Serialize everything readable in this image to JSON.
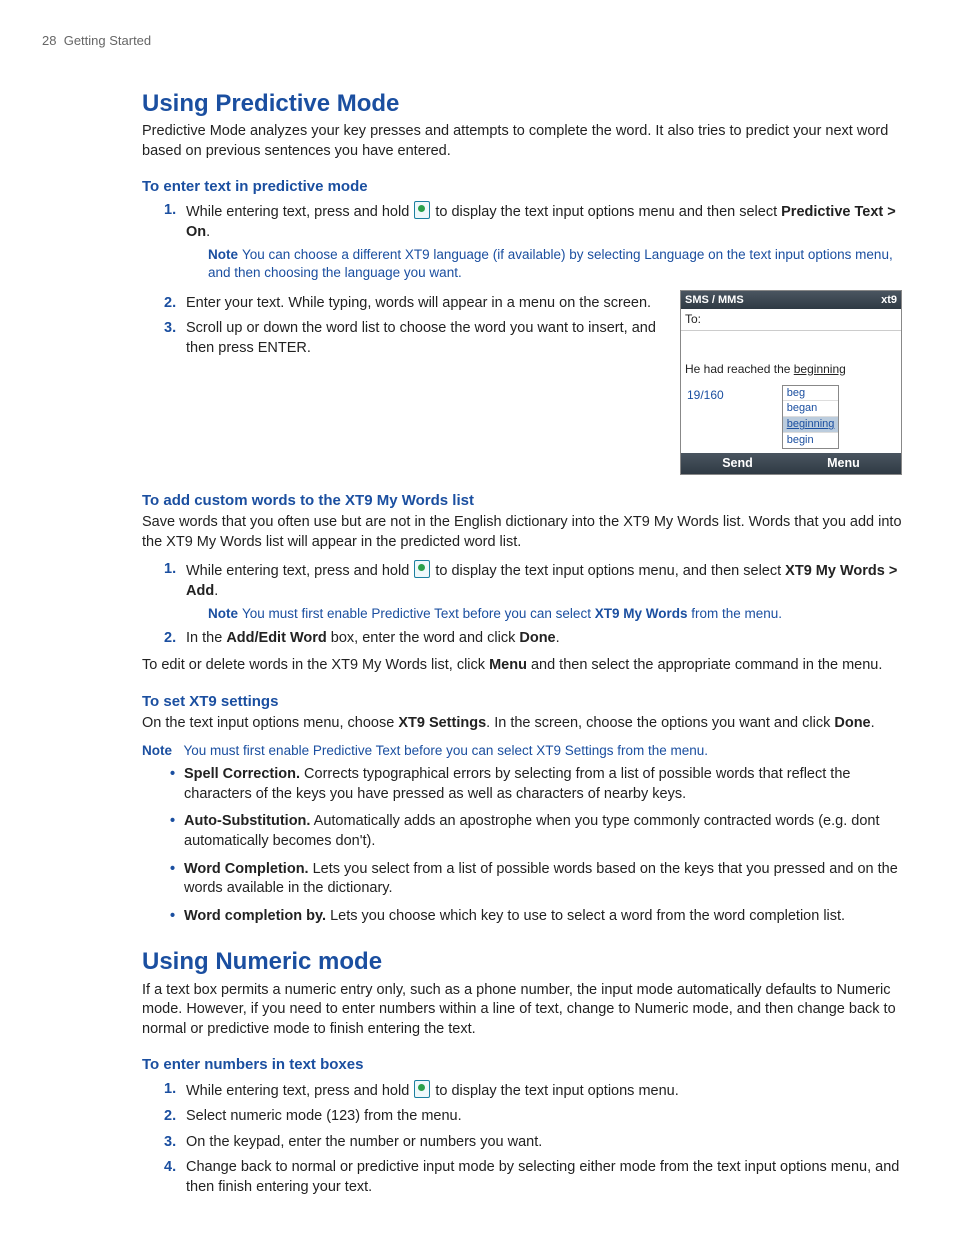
{
  "header": {
    "page_number": "28",
    "section": "Getting Started"
  },
  "predictive": {
    "title": "Using Predictive Mode",
    "intro": "Predictive Mode analyzes your key presses and attempts to complete the word. It also tries to predict your next word based on previous sentences you have entered.",
    "enter": {
      "heading": "To enter text in predictive mode",
      "step1_a": "While entering text, press and hold ",
      "step1_b": " to display the text input options menu and then select ",
      "step1_bold": "Predictive Text > On",
      "step1_c": ".",
      "note_label": "Note",
      "note": "You can choose a different XT9 language (if available) by selecting Language on the text input options menu, and then choosing the language you want.",
      "step2": "Enter your text. While typing, words will appear in a menu on the screen.",
      "step3": "Scroll up or down the word list to choose the word you want to insert, and then press ENTER."
    },
    "custom": {
      "heading": "To add custom words to the XT9 My Words list",
      "intro": "Save words that you often use but are not in the English dictionary into the XT9 My Words list. Words that you add into the XT9 My Words list will appear in the predicted word list.",
      "step1_a": "While entering text, press and hold ",
      "step1_b": " to display the text input options menu, and then select ",
      "step1_bold": "XT9 My Words > Add",
      "step1_c": ".",
      "note_label": "Note",
      "note_a": "You must first enable Predictive Text before you can select ",
      "note_bold": "XT9 My Words",
      "note_b": " from the menu.",
      "step2_a": "In the ",
      "step2_bold1": "Add/Edit Word",
      "step2_b": " box, enter the word and click ",
      "step2_bold2": "Done",
      "step2_c": ".",
      "outro_a": "To edit or delete words in the XT9 My Words list, click ",
      "outro_bold": "Menu",
      "outro_b": " and then select the appropriate command in the menu."
    },
    "settings": {
      "heading": "To set XT9 settings",
      "intro_a": "On the text input options menu, choose ",
      "intro_bold1": "XT9 Settings",
      "intro_b": ". In the screen, choose the options you want and click ",
      "intro_bold2": "Done",
      "intro_c": ".",
      "note_label": "Note",
      "note": "You must first enable Predictive Text before you can select XT9 Settings from the menu.",
      "bullets": {
        "spell_title": "Spell Correction.",
        "spell_body": " Corrects typographical errors by selecting from a list of possible words that reflect the characters of the keys you have pressed as well as characters of nearby keys.",
        "auto_title": "Auto-Substitution.",
        "auto_body": " Automatically adds an apostrophe when you type commonly contracted words (e.g. dont automatically becomes don't).",
        "comp_title": "Word Completion.",
        "comp_body": " Lets you select from a list of possible words based on the keys that you pressed and on the words available in the dictionary.",
        "compby_title": "Word completion by.",
        "compby_body": " Lets you choose which key to use to select a word from the word completion list."
      }
    }
  },
  "numeric": {
    "title": "Using Numeric mode",
    "intro": "If a text box permits a numeric entry only, such as a phone number, the input mode automatically defaults to Numeric mode. However, if you need to enter numbers within a line of text, change to Numeric mode, and then change back to normal or predictive mode to finish entering the text.",
    "heading": "To enter numbers in text boxes",
    "step1_a": "While entering text, press and hold ",
    "step1_b": " to display the text input options menu.",
    "step2": "Select numeric mode (123) from the menu.",
    "step3": "On the keypad, enter the number or numbers you want.",
    "step4": "Change back to normal or predictive input mode by selecting either mode from the text input options menu, and then finish entering your text."
  },
  "phone": {
    "title": "SMS / MMS",
    "indicator": "xt9",
    "to_label": "To:",
    "typed_a": "He had reached the ",
    "typed_ul": "beginning",
    "count": "19/160",
    "options": [
      "beg",
      "began",
      "beginning",
      "begin"
    ],
    "selected_index": 2,
    "soft_left": "Send",
    "soft_right": "Menu"
  }
}
